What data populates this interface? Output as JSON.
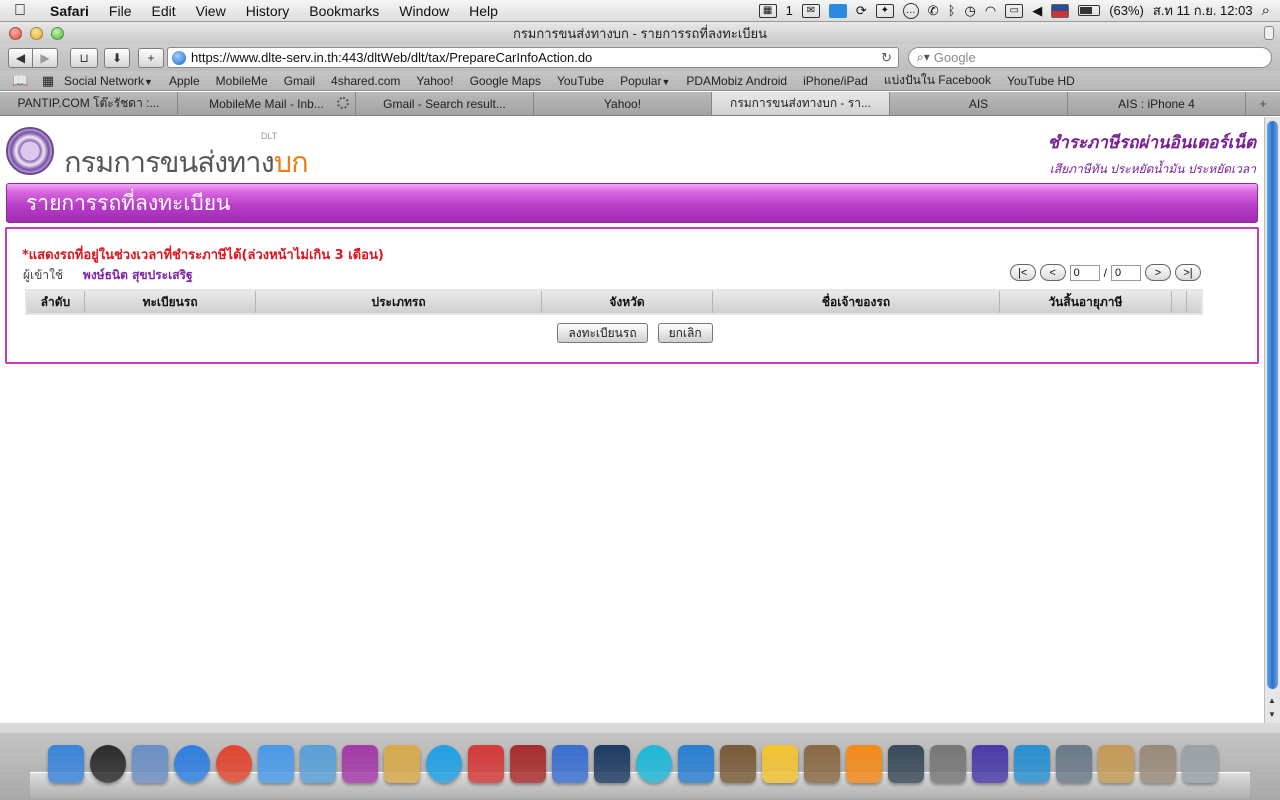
{
  "menubar": {
    "app": "Safari",
    "items": [
      "File",
      "Edit",
      "View",
      "History",
      "Bookmarks",
      "Window",
      "Help"
    ],
    "status": {
      "badge_count": "1",
      "battery": "(63%)",
      "clock": "ส.ท 11 ก.ย. 12:03"
    }
  },
  "window": {
    "title": "กรมการขนส่งทางบก - รายการรถที่ลงทะเบียน"
  },
  "toolbar": {
    "url": "https://www.dlte-serv.in.th:443/dltWeb/dlt/tax/PrepareCarInfoAction.do",
    "search_placeholder": "Google"
  },
  "bookmarks": [
    {
      "label": "Social Network",
      "menu": true
    },
    {
      "label": "Apple"
    },
    {
      "label": "MobileMe"
    },
    {
      "label": "Gmail"
    },
    {
      "label": "4shared.com"
    },
    {
      "label": "Yahoo!"
    },
    {
      "label": "Google Maps"
    },
    {
      "label": "YouTube"
    },
    {
      "label": "Popular",
      "menu": true
    },
    {
      "label": "PDAMobiz Android"
    },
    {
      "label": "iPhone/iPad"
    },
    {
      "label": "แบ่งปันใน Facebook"
    },
    {
      "label": "YouTube HD"
    }
  ],
  "tabs": [
    {
      "label": "PANTIP.COM โต๊ะรัชดา :..."
    },
    {
      "label": "MobileMe Mail - Inb...",
      "loading": true
    },
    {
      "label": "Gmail - Search result..."
    },
    {
      "label": "Yahoo!"
    },
    {
      "label": "กรมการขนส่งทางบก - รา...",
      "active": true
    },
    {
      "label": "AIS"
    },
    {
      "label": "AIS : iPhone 4"
    }
  ],
  "page": {
    "logo_main": "กรมการขนส่งทาง",
    "logo_accent": "บก",
    "logo_tag": "DLT",
    "slogan_line1": "ชำระภาษีรถผ่านอินเตอร์เน็ต",
    "slogan_line2": "เสียภาษีทัน ประหยัดน้ำมัน ประหยัดเวลา",
    "banner_title": "รายการรถที่ลงทะเบียน",
    "notice": "*แสดงรถที่อยู่ในช่วงเวลาที่ชำระภาษีได้(ล่วงหน้าไม่เกิน 3 เดือน)",
    "user_label": "ผู้เข้าใช้",
    "user_name": "พงษ์ธนิต สุขประเสริฐ",
    "pager": {
      "first": "|<",
      "prev": "<",
      "current": "0",
      "sep": "/",
      "total": "0",
      "next": ">",
      "last": ">|"
    },
    "table_headers": [
      "ลำดับ",
      "ทะเบียนรถ",
      "ประเภทรถ",
      "จังหวัด",
      "ชื่อเจ้าของรถ",
      "วันสิ้นอายุภาษี",
      "",
      ""
    ],
    "buttons": {
      "register": "ลงทะเบียนรถ",
      "cancel": "ยกเลิก"
    }
  },
  "dock": {
    "items": [
      {
        "name": "finder-icon",
        "color": "#3b86d9"
      },
      {
        "name": "dashboard-icon",
        "color": "#2b2b2b"
      },
      {
        "name": "mail-icon",
        "color": "#6c8fc4"
      },
      {
        "name": "safari-icon",
        "color": "#2f7fe0"
      },
      {
        "name": "chrome-icon",
        "color": "#e0462f"
      },
      {
        "name": "ichat-icon",
        "color": "#4a9ae8"
      },
      {
        "name": "address-book-icon",
        "color": "#5aa0d8"
      },
      {
        "name": "app-badge-icon",
        "color": "#a43aa8"
      },
      {
        "name": "address-card-icon",
        "color": "#d7a94b"
      },
      {
        "name": "skype-icon",
        "color": "#1fa0e3"
      },
      {
        "name": "ical-icon",
        "color": "#d43a3a"
      },
      {
        "name": "dictionary-icon",
        "color": "#a82d2d"
      },
      {
        "name": "itunes-icon",
        "color": "#3a6fd0"
      },
      {
        "name": "photoshop-icon",
        "color": "#1d3b63"
      },
      {
        "name": "globe-app-icon",
        "color": "#1fb8d8"
      },
      {
        "name": "bluetooth-app-icon",
        "color": "#2a7fd1"
      },
      {
        "name": "image-capture-icon",
        "color": "#7a5b3a"
      },
      {
        "name": "duck-app-icon",
        "color": "#f2c333"
      },
      {
        "name": "preview-icon",
        "color": "#8a6a44"
      },
      {
        "name": "vlc-icon",
        "color": "#f28a1a"
      },
      {
        "name": "time-machine-icon",
        "color": "#3a4a5a"
      },
      {
        "name": "system-preferences-icon",
        "color": "#777777"
      },
      {
        "name": "itunes-remote-icon",
        "color": "#4a3aa8"
      },
      {
        "name": "wave-app-icon",
        "color": "#2a8fd0"
      },
      {
        "name": "photo-booth-icon",
        "color": "#6a7a8a"
      },
      {
        "name": "documents-stack-icon",
        "color": "#c49a55"
      },
      {
        "name": "downloads-stack-icon",
        "color": "#9a8a7a"
      },
      {
        "name": "trash-icon",
        "color": "#9aa2a8"
      }
    ]
  }
}
